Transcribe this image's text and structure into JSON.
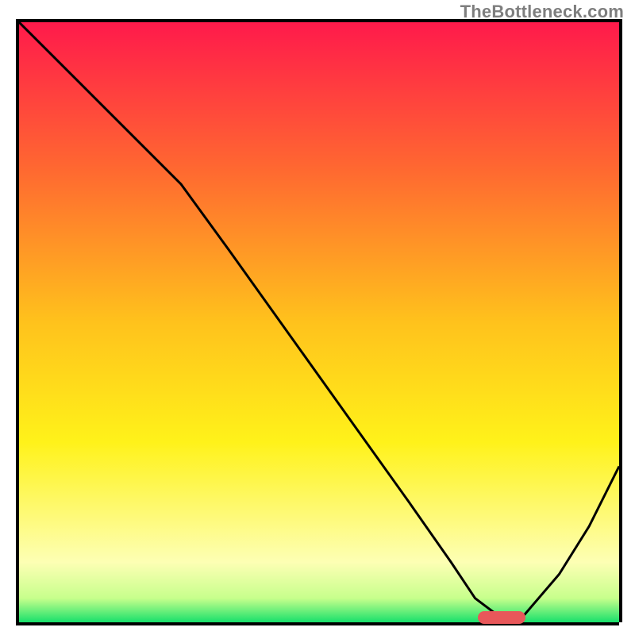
{
  "watermark": "TheBottleneck.com",
  "chart_data": {
    "type": "line",
    "title": "",
    "xlabel": "",
    "ylabel": "",
    "xlim": [
      0,
      100
    ],
    "ylim": [
      0,
      100
    ],
    "grid": false,
    "background_gradient": {
      "stops": [
        {
          "offset": 0.0,
          "color": "#ff1a4b"
        },
        {
          "offset": 0.25,
          "color": "#ff6a30"
        },
        {
          "offset": 0.5,
          "color": "#ffc21c"
        },
        {
          "offset": 0.7,
          "color": "#fff21a"
        },
        {
          "offset": 0.9,
          "color": "#fdffb4"
        },
        {
          "offset": 0.96,
          "color": "#c7ff8c"
        },
        {
          "offset": 1.0,
          "color": "#18e06b"
        }
      ]
    },
    "series": [
      {
        "name": "bottleneck-curve",
        "color": "#000000",
        "stroke_width": 3,
        "x": [
          0,
          10,
          20,
          27,
          35,
          45,
          55,
          65,
          72,
          76,
          80,
          84,
          90,
          95,
          100
        ],
        "y": [
          100,
          90,
          80,
          73,
          62,
          48,
          34,
          20,
          10,
          4,
          1,
          1,
          8,
          16,
          26
        ]
      }
    ],
    "optimal_marker": {
      "x_start": 76,
      "x_end": 84,
      "y": 0.8,
      "color": "#e8575a",
      "label": "optimal-range"
    }
  }
}
